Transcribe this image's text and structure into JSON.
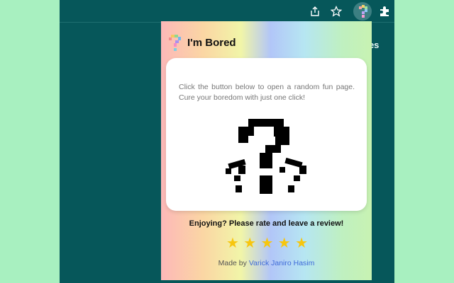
{
  "browser": {
    "toolbar_icons": [
      "share-icon",
      "star-icon",
      "extension-icon",
      "puzzle-icon"
    ],
    "background_text": "ges"
  },
  "popup": {
    "title": "I'm Bored",
    "description": "Click the button below to open a random fun page. Cure your boredom with just one click!",
    "main_button_icon": "pixel-question-marks-icon",
    "rate_prompt": "Enjoying? Please rate and leave a review!",
    "rating": {
      "stars_shown": 5,
      "star_color": "#f7c60e"
    },
    "credit_prefix": "Made by ",
    "credit_author": "Varick Janiro Hasim"
  },
  "colors": {
    "page_background": "#a8f0c0",
    "browser_background": "#06575a",
    "link": "#3f6ad8"
  }
}
